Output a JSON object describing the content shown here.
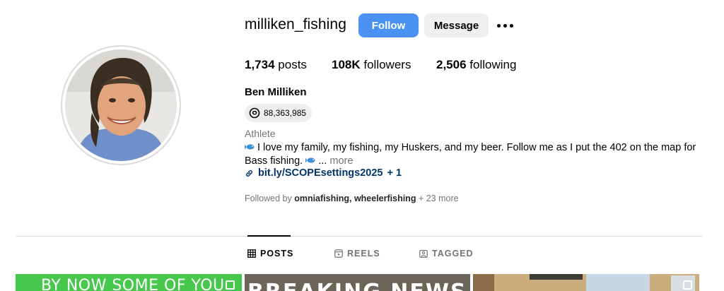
{
  "profile": {
    "username": "milliken_fishing",
    "full_name": "Ben Milliken",
    "threads_count": "88,363,985",
    "category": "Athlete",
    "bio_text": "I love my family, my fishing, my Huskers, and my beer. Follow me as I put the 402 on the map for Bass fishing.",
    "bio_ellipsis": "...",
    "bio_more": "more",
    "link_text": "bit.ly/SCOPEsettings2025",
    "link_extra": "+ 1",
    "followed_prefix": "Followed by",
    "followed_user_1": "omniafishing",
    "followed_separator": ",",
    "followed_user_2": "wheelerfishing",
    "followed_more": "+ 23 more"
  },
  "actions": {
    "follow_label": "Follow",
    "message_label": "Message"
  },
  "stats": {
    "posts_count": "1,734",
    "posts_label": "posts",
    "followers_count": "108K",
    "followers_label": "followers",
    "following_count": "2,506",
    "following_label": "following"
  },
  "tabs": [
    {
      "label": "POSTS",
      "icon": "grid-icon",
      "active": true
    },
    {
      "label": "REELS",
      "icon": "reels-icon",
      "active": false
    },
    {
      "label": "TAGGED",
      "icon": "tagged-icon",
      "active": false
    }
  ],
  "grid": {
    "post_1_text": "BY NOW SOME OF YOU",
    "post_2_text": "BREAKING NEWS"
  },
  "colors": {
    "follow_button": "#4a93f5",
    "link": "#00376b",
    "muted": "#737373"
  }
}
